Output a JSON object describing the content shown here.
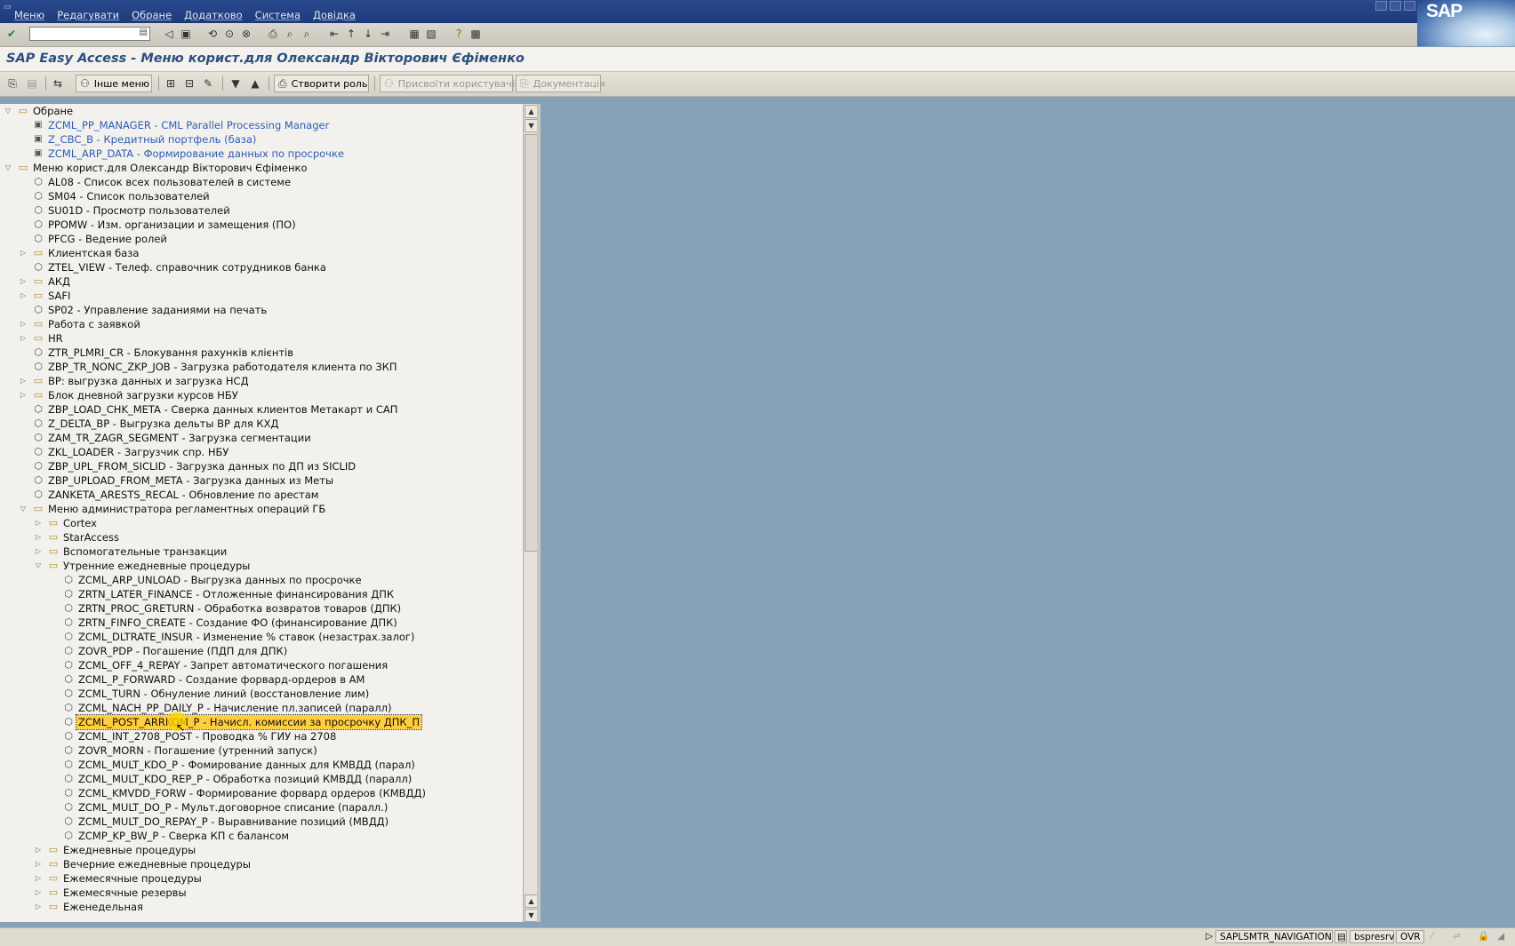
{
  "menubar": {
    "items": [
      "Меню",
      "Редагувати",
      "Обране",
      "Додатково",
      "Система",
      "Довідка"
    ],
    "logo": "SAP"
  },
  "toolbar": {
    "command_value": "",
    "icons": [
      "enter-icon",
      "save-icon",
      "back-icon",
      "exit-icon",
      "cancel-icon",
      "print-icon",
      "find-icon",
      "find-next-icon",
      "first-page-icon",
      "prev-page-icon",
      "next-page-icon",
      "last-page-icon",
      "new-session-icon",
      "shortcut-icon",
      "help-icon",
      "layout-icon"
    ]
  },
  "title": "SAP Easy Access  -  Меню корист.для Олександр Вікторович Єфіменко",
  "appbar": {
    "other_menu": "Інше меню",
    "create_role": "Створити роль",
    "assign_users": "Присвоїти користувачів",
    "documentation": "Документація"
  },
  "tree": [
    {
      "text": "Обране",
      "type": "folder",
      "level": 0,
      "expanded": true
    },
    {
      "text": "ZCML_PP_MANAGER - CML Parallel Processing Manager",
      "type": "fav",
      "level": 1
    },
    {
      "text": "Z_CBC_B - Кредитный портфель (база)",
      "type": "fav",
      "level": 1
    },
    {
      "text": "ZCML_ARP_DATA - Формирование данных по просрочке",
      "type": "fav",
      "level": 1
    },
    {
      "text": "Меню корист.для Олександр Вікторович Єфіменко",
      "type": "folder",
      "level": 0,
      "expanded": true
    },
    {
      "text": "AL08 - Список всех пользователей в системе",
      "type": "tcode",
      "level": 1
    },
    {
      "text": "SM04 - Список пользователей",
      "type": "tcode",
      "level": 1
    },
    {
      "text": "SU01D - Просмотр пользователей",
      "type": "tcode",
      "level": 1
    },
    {
      "text": "PPOMW - Изм. организации и замещения (ПО)",
      "type": "tcode",
      "level": 1
    },
    {
      "text": "PFCG - Ведение ролей",
      "type": "tcode",
      "level": 1
    },
    {
      "text": "Клиентская база",
      "type": "folder",
      "level": 1,
      "expanded": false
    },
    {
      "text": "ZTEL_VIEW - Телеф. справочник сотрудников банка",
      "type": "tcode",
      "level": 1
    },
    {
      "text": "АКД",
      "type": "folder",
      "level": 1,
      "expanded": false
    },
    {
      "text": "SAFI",
      "type": "folder",
      "level": 1,
      "expanded": false
    },
    {
      "text": "SP02 - Управление заданиями на печать",
      "type": "tcode",
      "level": 1
    },
    {
      "text": "Работа с заявкой",
      "type": "folder",
      "level": 1,
      "expanded": false
    },
    {
      "text": "HR",
      "type": "folder",
      "level": 1,
      "expanded": false
    },
    {
      "text": "ZTR_PLMRI_CR - Блокування рахунків клієнтів",
      "type": "tcode",
      "level": 1
    },
    {
      "text": "ZBP_TR_NONC_ZKP_JOB - Загрузка работодателя клиента по ЗКП",
      "type": "tcode",
      "level": 1
    },
    {
      "text": "BP: выгрузка данных и загрузка НСД",
      "type": "folder",
      "level": 1,
      "expanded": false
    },
    {
      "text": "Блок дневной загрузки курсов НБУ",
      "type": "folder",
      "level": 1,
      "expanded": false
    },
    {
      "text": "ZBP_LOAD_CHK_META - Сверка данных клиентов Метакарт и САП",
      "type": "tcode",
      "level": 1
    },
    {
      "text": "Z_DELTA_BP - Выгрузка дельты BP для КХД",
      "type": "tcode",
      "level": 1
    },
    {
      "text": "ZAM_TR_ZAGR_SEGMENT - Загрузка сегментации",
      "type": "tcode",
      "level": 1
    },
    {
      "text": "ZKL_LOADER - Загрузчик спр. НБУ",
      "type": "tcode",
      "level": 1
    },
    {
      "text": "ZBP_UPL_FROM_SICLID - Загрузка данных по ДП из SICLID",
      "type": "tcode",
      "level": 1
    },
    {
      "text": "ZBP_UPLOAD_FROM_META - Загрузка данных из Меты",
      "type": "tcode",
      "level": 1
    },
    {
      "text": "ZANKETA_ARESTS_RECAL - Обновление по арестам",
      "type": "tcode",
      "level": 1
    },
    {
      "text": "Меню администратора регламентных операций ГБ",
      "type": "folder",
      "level": 1,
      "expanded": true
    },
    {
      "text": "Cortex",
      "type": "folder",
      "level": 2,
      "expanded": false
    },
    {
      "text": "StarAccess",
      "type": "folder",
      "level": 2,
      "expanded": false
    },
    {
      "text": "Вспомогательные транзакции",
      "type": "folder",
      "level": 2,
      "expanded": false
    },
    {
      "text": "Утренние ежедневные процедуры",
      "type": "folder",
      "level": 2,
      "expanded": true
    },
    {
      "text": "ZCML_ARP_UNLOAD - Выгрузка данных по просрочке",
      "type": "tcode",
      "level": 3
    },
    {
      "text": "ZRTN_LATER_FINANCE - Отложенные финансирования ДПК",
      "type": "tcode",
      "level": 3
    },
    {
      "text": "ZRTN_PROC_GRETURN - Обработка возвратов товаров (ДПК)",
      "type": "tcode",
      "level": 3
    },
    {
      "text": "ZRTN_FINFO_CREATE - Создание ФО (финансирование ДПК)",
      "type": "tcode",
      "level": 3
    },
    {
      "text": "ZCML_DLTRATE_INSUR - Изменение % ставок (незастрах.залог)",
      "type": "tcode",
      "level": 3
    },
    {
      "text": "ZOVR_PDP - Погашение (ПДП для ДПК)",
      "type": "tcode",
      "level": 3
    },
    {
      "text": "ZCML_OFF_4_REPAY - Запрет автоматического погашения",
      "type": "tcode",
      "level": 3
    },
    {
      "text": "ZCML_P_FORWARD - Создание форвард-ордеров в АМ",
      "type": "tcode",
      "level": 3
    },
    {
      "text": "ZCML_TURN - Обнуление линий (восстановление лим)",
      "type": "tcode",
      "level": 3
    },
    {
      "text": "ZCML_NACH_PP_DAILY_P - Начисление пл.записей (паралл)",
      "type": "tcode",
      "level": 3
    },
    {
      "text": "ZCML_POST_ARRKOM_P - Начисл. комиссии за просрочку ДПК_П",
      "type": "tcode",
      "level": 3,
      "selected": true
    },
    {
      "text": "ZCML_INT_2708_POST - Проводка % ГИУ на 2708",
      "type": "tcode",
      "level": 3
    },
    {
      "text": "ZOVR_MORN - Погашение (утренний запуск)",
      "type": "tcode",
      "level": 3
    },
    {
      "text": "ZCML_MULT_KDO_P - Фомирование данных для КМВДД (парал)",
      "type": "tcode",
      "level": 3
    },
    {
      "text": "ZCML_MULT_KDO_REP_P - Обработка позиций КМВДД (паралл)",
      "type": "tcode",
      "level": 3
    },
    {
      "text": "ZCML_KMVDD_FORW - Формирование форвард ордеров (КМВДД)",
      "type": "tcode",
      "level": 3
    },
    {
      "text": "ZCML_MULT_DO_P - Мульт.договорное списание (паралл.)",
      "type": "tcode",
      "level": 3
    },
    {
      "text": "ZCML_MULT_DO_REPAY_P - Выравнивание позиций (МВДД)",
      "type": "tcode",
      "level": 3
    },
    {
      "text": "ZCMP_KP_BW_P - Сверка КП с балансом",
      "type": "tcode",
      "level": 3
    },
    {
      "text": "Ежедневные процедуры",
      "type": "folder",
      "level": 2,
      "expanded": false
    },
    {
      "text": "Вечерние ежедневные процедуры",
      "type": "folder",
      "level": 2,
      "expanded": false
    },
    {
      "text": "Ежемесячные процедуры",
      "type": "folder",
      "level": 2,
      "expanded": false
    },
    {
      "text": "Ежемесячные резервы",
      "type": "folder",
      "level": 2,
      "expanded": false
    },
    {
      "text": "Еженедельная",
      "type": "folder",
      "level": 2,
      "expanded": false
    }
  ],
  "statusbar": {
    "program": "SAPLSMTR_NAVIGATION",
    "server": "bspresrv",
    "mode": "OVR"
  }
}
